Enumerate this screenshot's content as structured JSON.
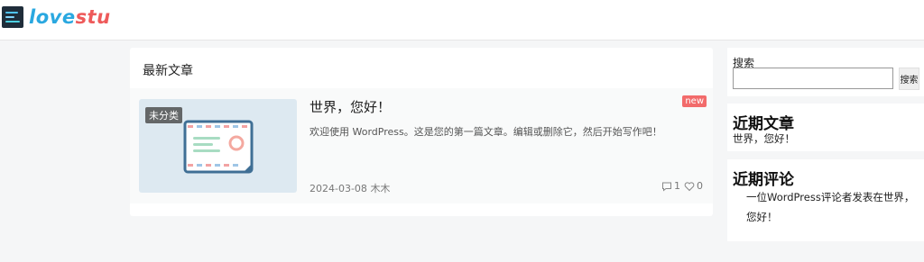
{
  "header": {
    "logo_part1": "love",
    "logo_part2": "stu",
    "logo_icon": "terminal-logo-icon"
  },
  "main": {
    "section_title": "最新文章",
    "post": {
      "category": "未分类",
      "title": "世界，您好！",
      "excerpt": "欢迎使用 WordPress。这是您的第一篇文章。编辑或删除它，然后开始写作吧！",
      "badge": "new",
      "date": "2024-03-08",
      "author": "木木",
      "comments": "1",
      "likes": "0",
      "thumbnail_icon": "browser-window-illustration",
      "comment_icon": "comment-icon",
      "like_icon": "heart-icon"
    }
  },
  "sidebar": {
    "search": {
      "label": "搜索",
      "button": "搜索",
      "value": ""
    },
    "recent_posts": {
      "title": "近期文章",
      "items": [
        "世界，您好！"
      ]
    },
    "recent_comments": {
      "title": "近期评论",
      "items": [
        "一位WordPress评论者发表在世界，您好！"
      ]
    }
  },
  "colors": {
    "accent_blue": "#2aa8e0",
    "accent_red": "#ee5a5a",
    "badge": "#f26b6b",
    "background": "#f5f6f7"
  }
}
